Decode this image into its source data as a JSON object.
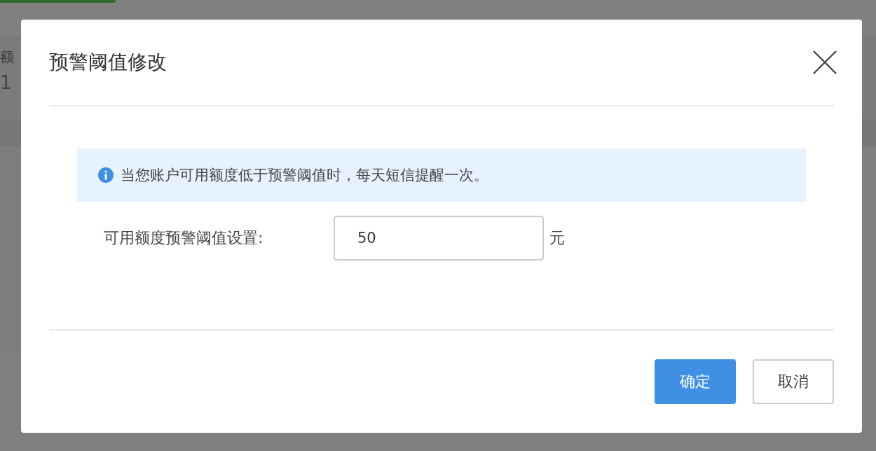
{
  "background": {
    "column_header": "额",
    "column_value": "1"
  },
  "dialog": {
    "title": "预警阈值修改",
    "notice": "当您账户可用额度低于预警阈值时，每天短信提醒一次。",
    "field": {
      "label": "可用额度预警阈值设置:",
      "value": "50",
      "unit": "元"
    },
    "buttons": [
      {
        "label": "确定",
        "kind": "primary"
      },
      {
        "label": "取消",
        "kind": "default"
      }
    ]
  }
}
